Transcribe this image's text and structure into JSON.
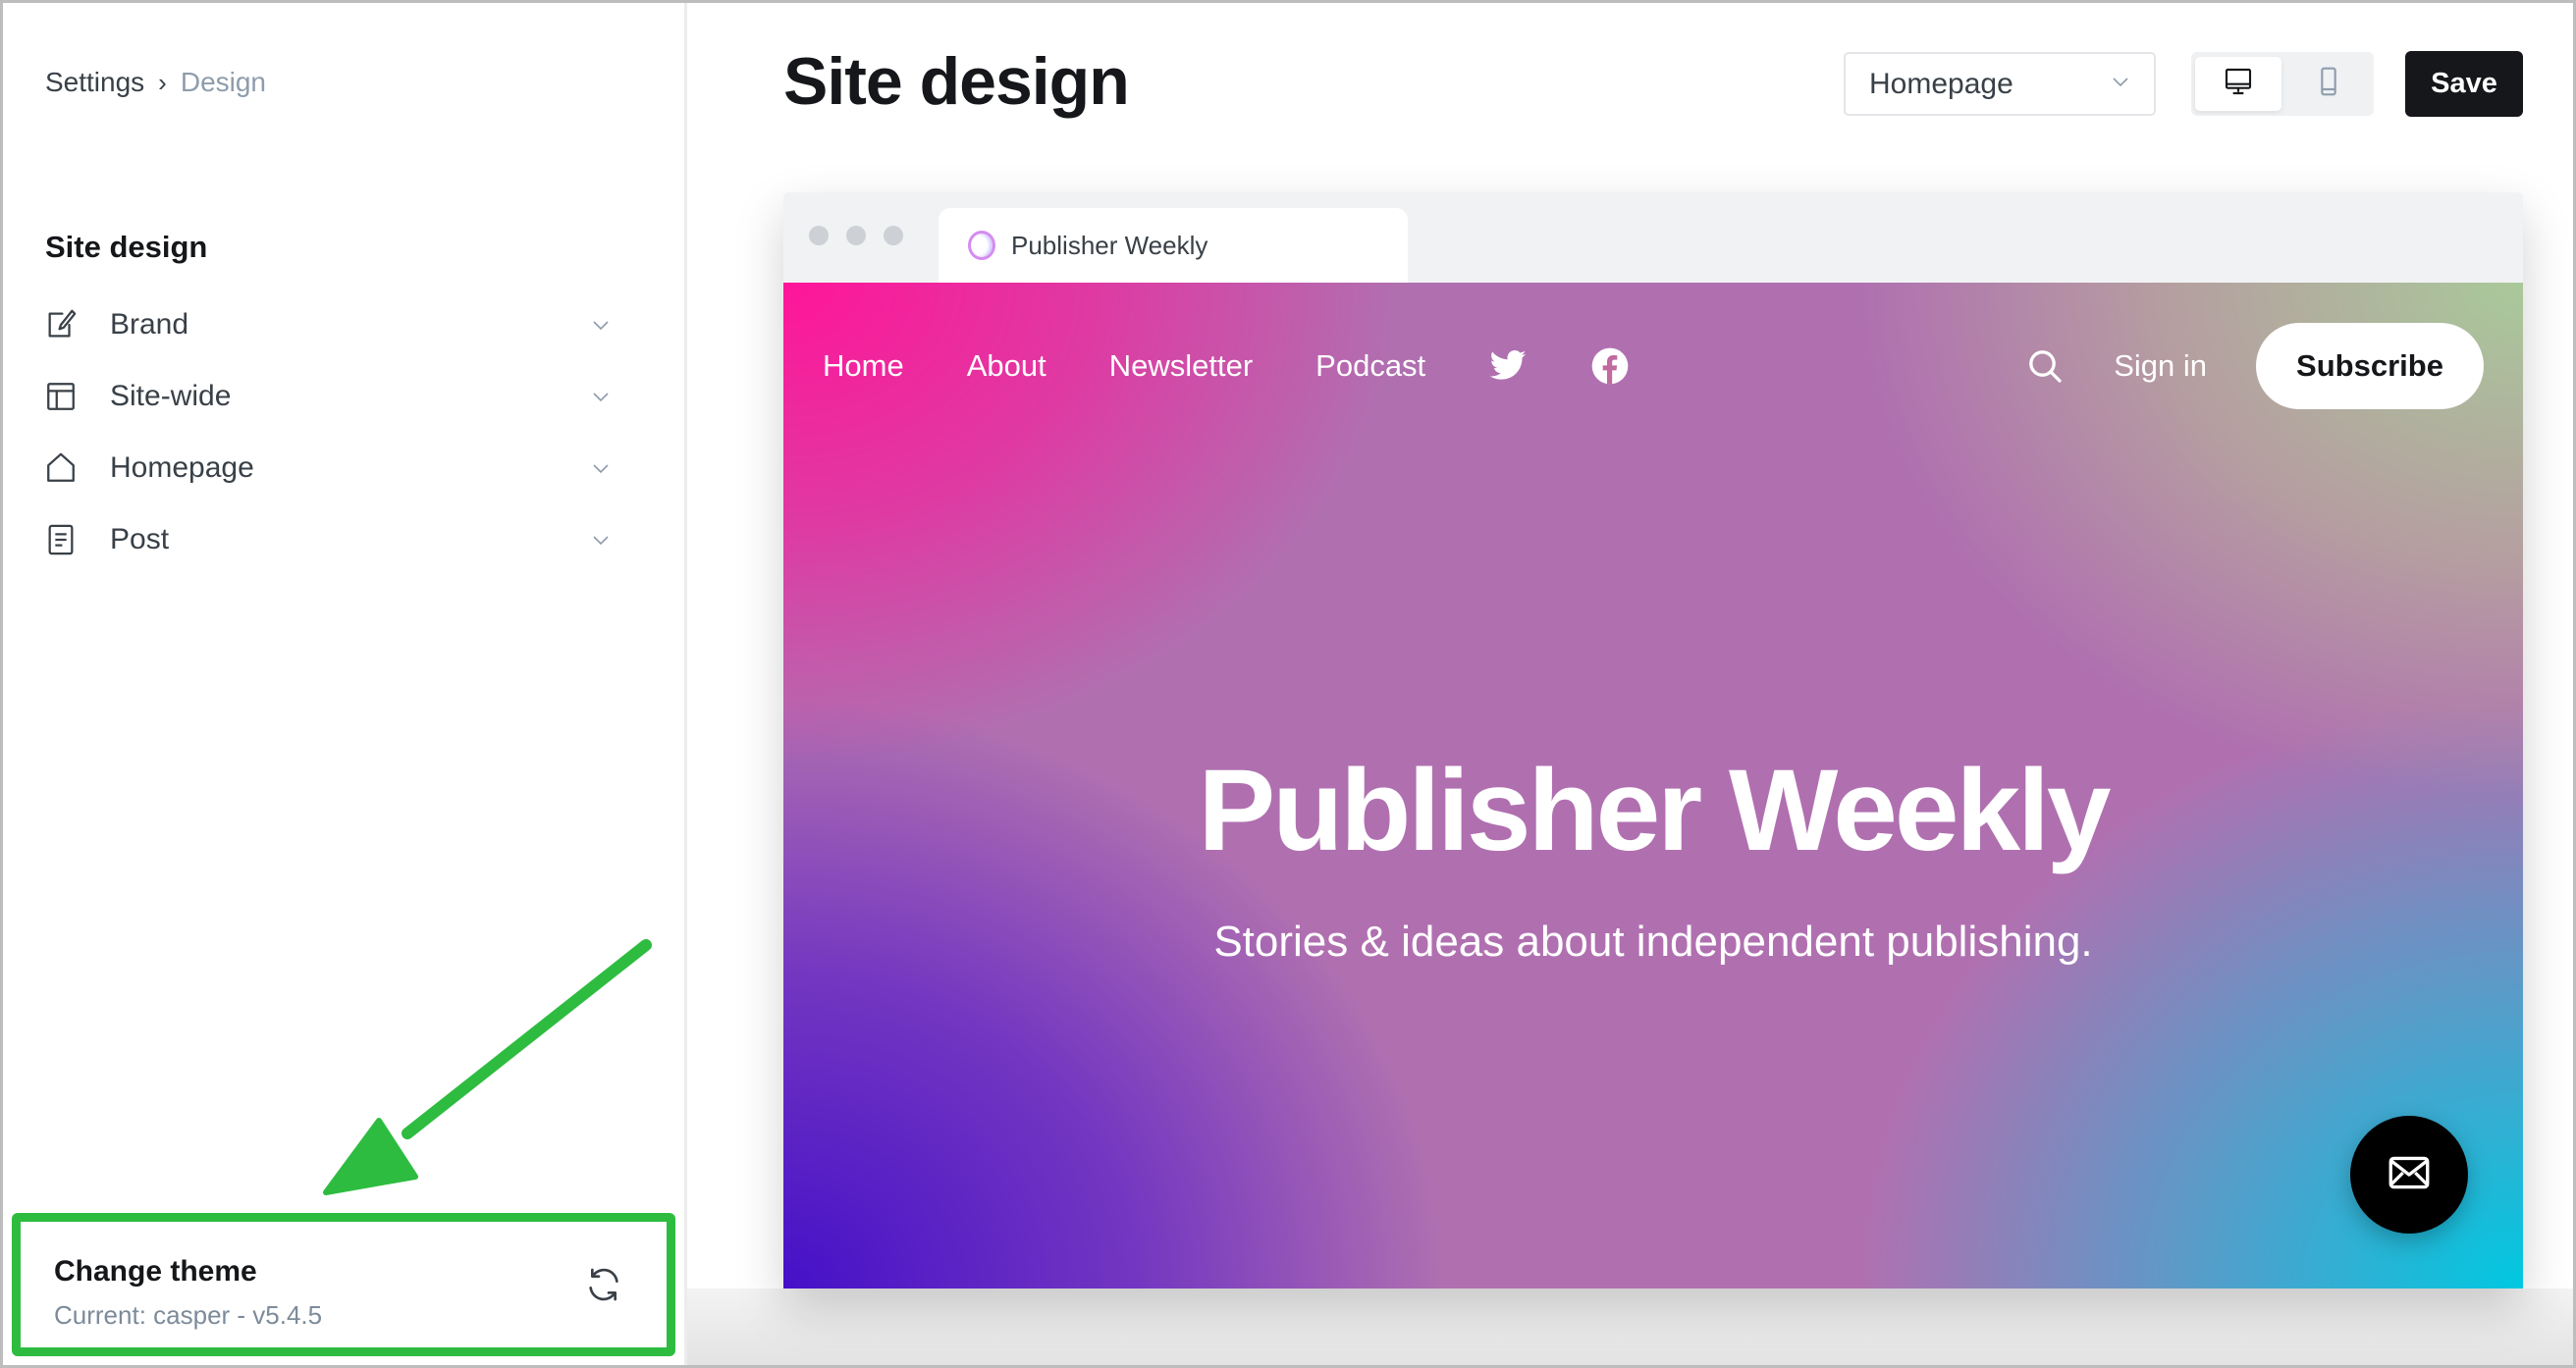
{
  "breadcrumb": {
    "parent": "Settings",
    "separator": "›",
    "current": "Design"
  },
  "sidebar": {
    "heading": "Site design",
    "items": [
      {
        "label": "Brand",
        "icon": "brush-icon"
      },
      {
        "label": "Site-wide",
        "icon": "layout-icon"
      },
      {
        "label": "Homepage",
        "icon": "home-icon"
      },
      {
        "label": "Post",
        "icon": "document-icon"
      }
    ],
    "theme": {
      "title": "Change theme",
      "current": "Current: casper - v5.4.5",
      "icon": "refresh-icon"
    }
  },
  "header": {
    "title": "Site design",
    "page_select": {
      "value": "Homepage"
    },
    "view_toggle": {
      "active": "desktop",
      "options": [
        "desktop",
        "mobile"
      ]
    },
    "save_label": "Save"
  },
  "preview": {
    "tab_title": "Publisher Weekly",
    "nav": {
      "links": [
        "Home",
        "About",
        "Newsletter",
        "Podcast"
      ],
      "social": [
        "twitter-icon",
        "facebook-icon"
      ],
      "signin": "Sign in",
      "subscribe": "Subscribe"
    },
    "hero": {
      "title": "Publisher Weekly",
      "subtitle": "Stories & ideas about independent publishing."
    },
    "gradient_colors": {
      "top_left": "#ff1599",
      "top_right": "#a9c99a",
      "bottom_left": "#4510c8",
      "bottom_right": "#00c8e0"
    }
  },
  "annotation": {
    "color": "#2ebc40"
  }
}
